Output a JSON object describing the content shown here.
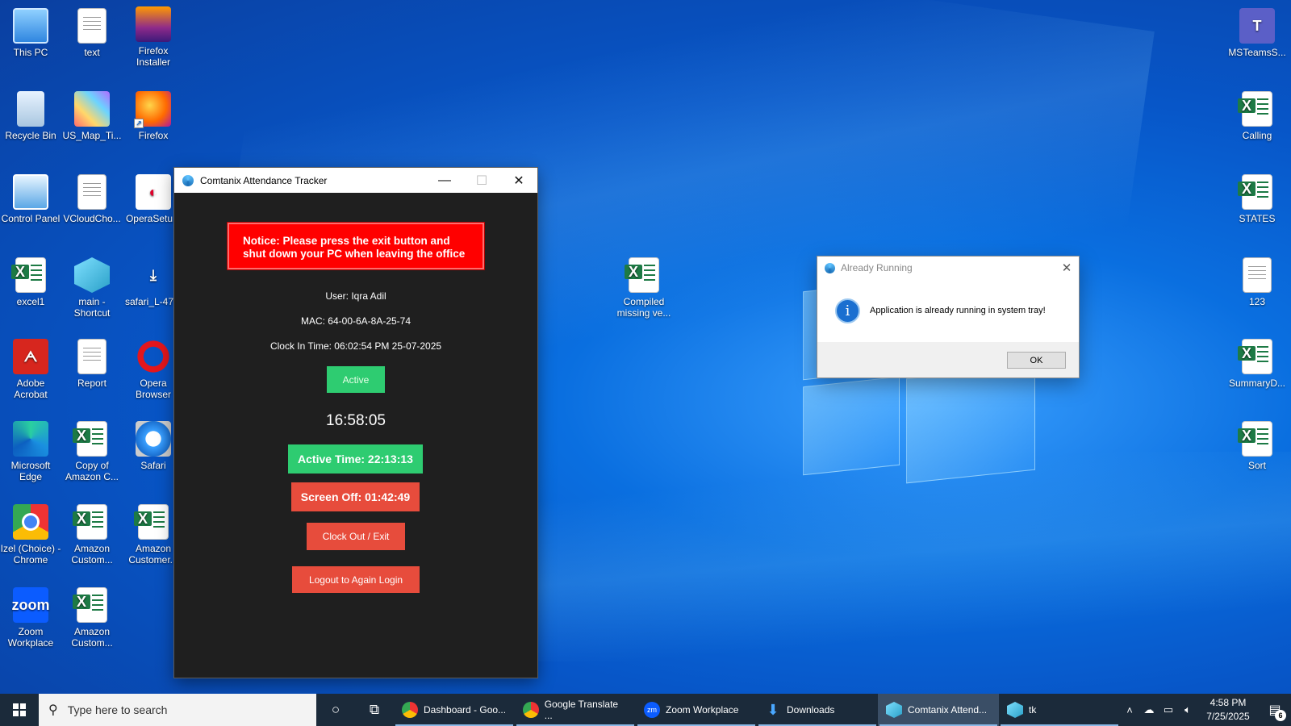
{
  "desktop": {
    "icons_left": [
      {
        "label": "This PC",
        "icon": "computer-icon"
      },
      {
        "label": "text",
        "icon": "document-icon"
      },
      {
        "label": "Firefox Installer",
        "icon": "firefox-installer-icon"
      },
      {
        "label": "Recycle Bin",
        "icon": "recycle-bin-icon"
      },
      {
        "label": "US_Map_Ti...",
        "icon": "image-icon"
      },
      {
        "label": "Firefox",
        "icon": "firefox-icon"
      },
      {
        "label": "Control Panel",
        "icon": "control-panel-icon"
      },
      {
        "label": "VCloudCho...",
        "icon": "document-icon"
      },
      {
        "label": "OperaSetu...",
        "icon": "opera-setup-icon"
      },
      {
        "label": "excel1",
        "icon": "excel-icon"
      },
      {
        "label": "main - Shortcut",
        "icon": "app-shortcut-icon"
      },
      {
        "label": "safari_L-47...",
        "icon": "download-icon"
      },
      {
        "label": "Adobe Acrobat",
        "icon": "acrobat-icon"
      },
      {
        "label": "Report",
        "icon": "document-icon"
      },
      {
        "label": "Opera Browser",
        "icon": "opera-icon"
      },
      {
        "label": "Microsoft Edge",
        "icon": "edge-icon"
      },
      {
        "label": "Copy of Amazon C...",
        "icon": "excel-icon"
      },
      {
        "label": "Safari",
        "icon": "safari-icon"
      },
      {
        "label": "Izel (Choice) - Chrome",
        "icon": "chrome-icon"
      },
      {
        "label": "Amazon Custom...",
        "icon": "excel-icon"
      },
      {
        "label": "Amazon Customer...",
        "icon": "excel-icon"
      },
      {
        "label": "Zoom Workplace",
        "icon": "zoom-icon"
      },
      {
        "label": "Amazon Custom...",
        "icon": "excel-icon"
      }
    ],
    "icons_right": [
      {
        "label": "MSTeamsS...",
        "icon": "teams-icon"
      },
      {
        "label": "Calling",
        "icon": "excel-icon"
      },
      {
        "label": "STATES",
        "icon": "excel-icon"
      },
      {
        "label": "123",
        "icon": "document-icon"
      },
      {
        "label": "SummaryD...",
        "icon": "excel-icon"
      },
      {
        "label": "Sort",
        "icon": "excel-icon"
      }
    ],
    "icon_center": {
      "label": "Compiled missing ve...",
      "icon": "excel-icon"
    },
    "zoom_glyph": "zoom",
    "excel_glyph": "X"
  },
  "app_window": {
    "title": "Comtanix Attendance Tracker",
    "notice": "Notice: Please press the exit button and shut down your PC when leaving the office",
    "user": "User: Iqra Adil",
    "mac": "MAC: 64-00-6A-8A-25-74",
    "clock_in": "Clock In Time: 06:02:54 PM 25-07-2025",
    "status": "Active",
    "current_time": "16:58:05",
    "active_time": "Active Time: 22:13:13",
    "screen_off": "Screen Off: 01:42:49",
    "clock_out_label": "Clock Out / Exit",
    "logout_label": "Logout to Again Login",
    "colors": {
      "active": "#2ecc71",
      "danger": "#e74c3c",
      "notice": "#ff0000",
      "background": "#1f1f1f"
    }
  },
  "dialog": {
    "title": "Already Running",
    "message": "Application is already running in system tray!",
    "ok_label": "OK"
  },
  "taskbar": {
    "search_placeholder": "Type here to search",
    "apps": [
      {
        "label": "Dashboard - Goo...",
        "icon": "chrome-icon"
      },
      {
        "label": "Google Translate ...",
        "icon": "chrome-icon"
      },
      {
        "label": "Zoom Workplace",
        "icon": "zoom-icon"
      },
      {
        "label": "Downloads",
        "icon": "download-folder-icon"
      },
      {
        "label": "Comtanix Attend...",
        "icon": "comtanix-icon",
        "active": true
      },
      {
        "label": "tk",
        "icon": "tk-icon"
      }
    ],
    "zoom_short": "zm",
    "time": "4:58 PM",
    "date": "7/25/2025",
    "notification_count": "6"
  }
}
